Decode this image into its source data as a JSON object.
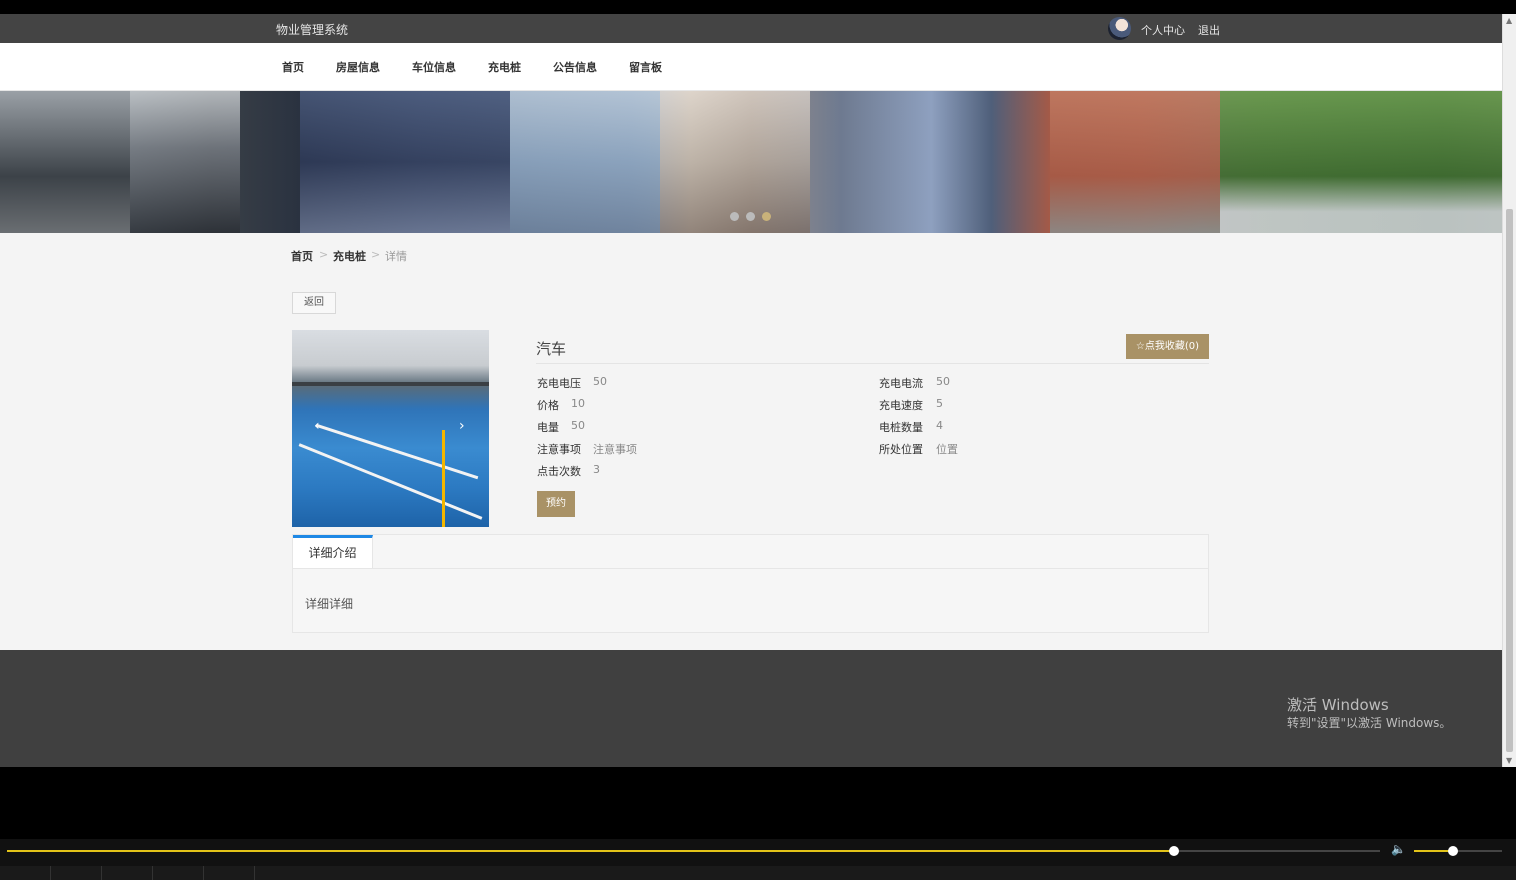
{
  "header": {
    "site_title": "物业管理系统",
    "user_center": "个人中心",
    "logout": "退出"
  },
  "nav": {
    "items": [
      "首页",
      "房屋信息",
      "车位信息",
      "充电桩",
      "公告信息",
      "留言板"
    ]
  },
  "banner": {
    "slide_count": 3,
    "active_slide": 3
  },
  "breadcrumb": {
    "home": "首页",
    "section": "充电桩",
    "current": "详情",
    "separator": ">"
  },
  "back_button": "返回",
  "detail": {
    "title": "汽车",
    "favorite_button": "点我收藏(0)",
    "fields_left": [
      {
        "label": "充电电压",
        "value": "50"
      },
      {
        "label": "价格",
        "value": "10"
      },
      {
        "label": "电量",
        "value": "50"
      },
      {
        "label": "注意事项",
        "value": "注意事项"
      },
      {
        "label": "点击次数",
        "value": "3"
      }
    ],
    "fields_right": [
      {
        "label": "充电电流",
        "value": "50"
      },
      {
        "label": "充电速度",
        "value": "5"
      },
      {
        "label": "电桩数量",
        "value": "4"
      },
      {
        "label": "所处位置",
        "value": "位置"
      }
    ],
    "book_button": "预约"
  },
  "tabs": {
    "active_tab": "详细介绍",
    "content": "详细详细"
  },
  "windows_watermark": {
    "line1": "激活 Windows",
    "line2": "转到\"设置\"以激活 Windows。"
  },
  "player": {
    "seek_progress": 0.85,
    "volume_level": 0.44
  },
  "colors": {
    "accent_gold": "#a99266",
    "tab_blue": "#1e88e5",
    "header_gray": "#444444",
    "progress_yellow": "#e2c319"
  }
}
